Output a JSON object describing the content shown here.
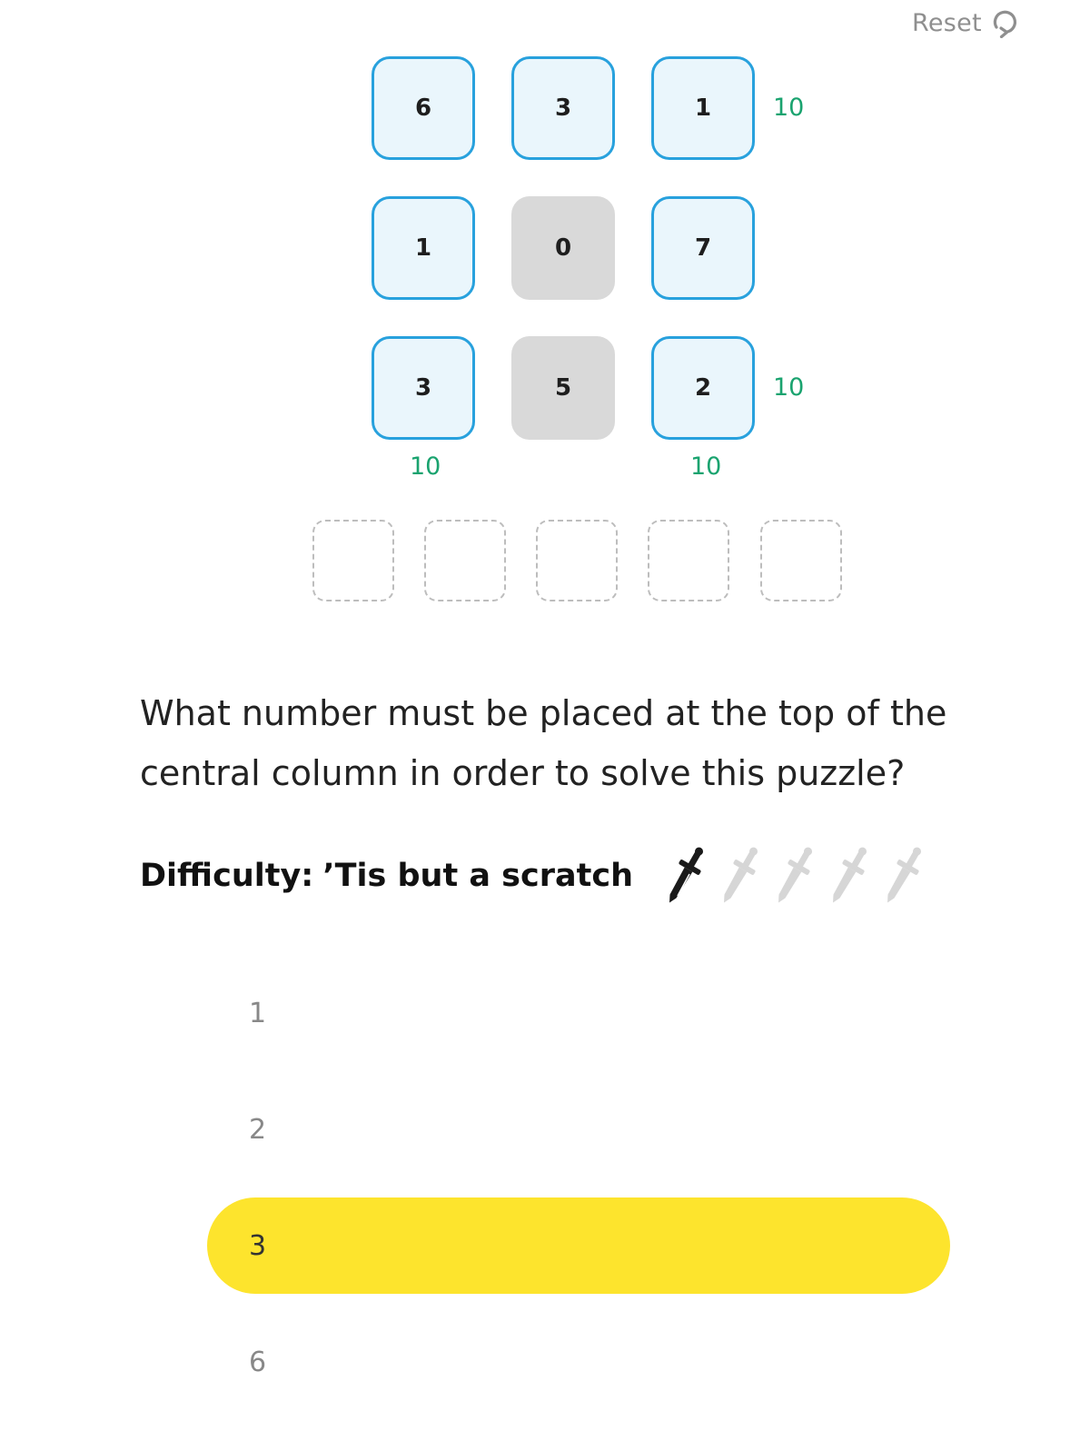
{
  "reset": {
    "label": "Reset",
    "icon": "refresh-icon"
  },
  "grid": {
    "rows": [
      [
        {
          "value": "6",
          "state": "active"
        },
        {
          "value": "3",
          "state": "active"
        },
        {
          "value": "1",
          "state": "active"
        }
      ],
      [
        {
          "value": "1",
          "state": "active"
        },
        {
          "value": "0",
          "state": "locked"
        },
        {
          "value": "7",
          "state": "active"
        }
      ],
      [
        {
          "value": "3",
          "state": "active"
        },
        {
          "value": "5",
          "state": "locked"
        },
        {
          "value": "2",
          "state": "active"
        }
      ]
    ],
    "row_sums": [
      "10",
      "",
      "10"
    ],
    "column_sums": [
      "10",
      "",
      "10"
    ],
    "empty_slots": 5
  },
  "question": "What number must be placed at the top of the central column in order to solve this puzzle?",
  "difficulty": {
    "label": "Difficulty:",
    "value": "’Tis but a scratch",
    "level": 1,
    "max": 5,
    "icon": "sword-icon"
  },
  "options": [
    {
      "label": "1",
      "selected": false
    },
    {
      "label": "2",
      "selected": false
    },
    {
      "label": "3",
      "selected": true
    },
    {
      "label": "6",
      "selected": false
    }
  ],
  "colors": {
    "tile_border": "#28a1dd",
    "tile_fill": "#eaf6fc",
    "locked_fill": "#d9d9d9",
    "sum_text": "#1aa36f",
    "selected_option": "#fde42d"
  }
}
